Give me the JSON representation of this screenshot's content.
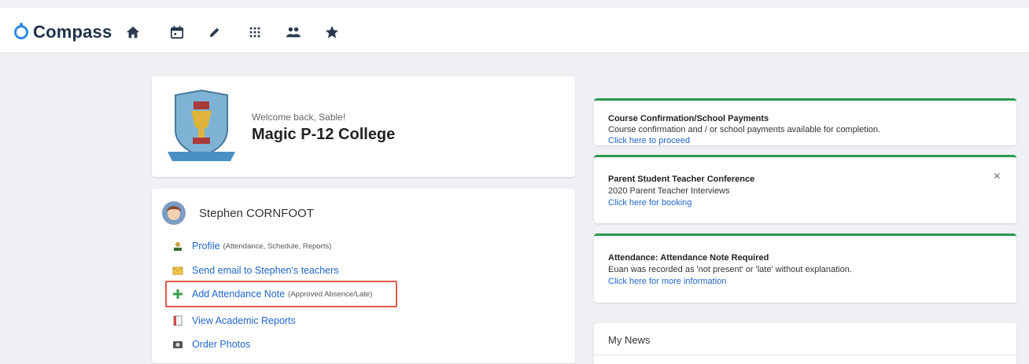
{
  "brand": {
    "name": "Compass",
    "accent": "#2b8be6"
  },
  "nav": {
    "icons": [
      "home-icon",
      "calendar-icon",
      "pencil-icon",
      "grid-icon",
      "people-icon",
      "star-icon"
    ]
  },
  "school": {
    "welcome": "Welcome back, Sable!",
    "name": "Magic P-12 College"
  },
  "student": {
    "name": "Stephen CORNFOOT",
    "links": [
      {
        "label": "Profile",
        "note": "(Attendance, Schedule, Reports)",
        "icon": "profile-icon"
      },
      {
        "label": "Send email to Stephen's teachers",
        "note": "",
        "icon": "email-icon"
      },
      {
        "label": "Add Attendance Note",
        "note": "(Approved Absence/Late)",
        "icon": "plus-icon"
      },
      {
        "label": "View Academic Reports",
        "note": "",
        "icon": "report-icon"
      },
      {
        "label": "Order Photos",
        "note": "",
        "icon": "photo-icon"
      }
    ]
  },
  "notices": [
    {
      "title": "Course Confirmation/School Payments",
      "body": "Course confirmation and / or school payments available for completion.",
      "link": "Click here to proceed"
    },
    {
      "title": "Parent Student Teacher Conference",
      "body": "2020 Parent Teacher Interviews",
      "link": "Click here for booking",
      "close": "×"
    },
    {
      "title": "Attendance: Attendance Note Required",
      "body": "Euan was recorded as 'not present' or 'late' without explanation.",
      "link": "Click here for more information"
    }
  ],
  "news": {
    "title": "My News"
  },
  "colors": {
    "notice_border": "#2a9a4e",
    "link": "#1f66c9",
    "highlight": "#e05a4c"
  }
}
